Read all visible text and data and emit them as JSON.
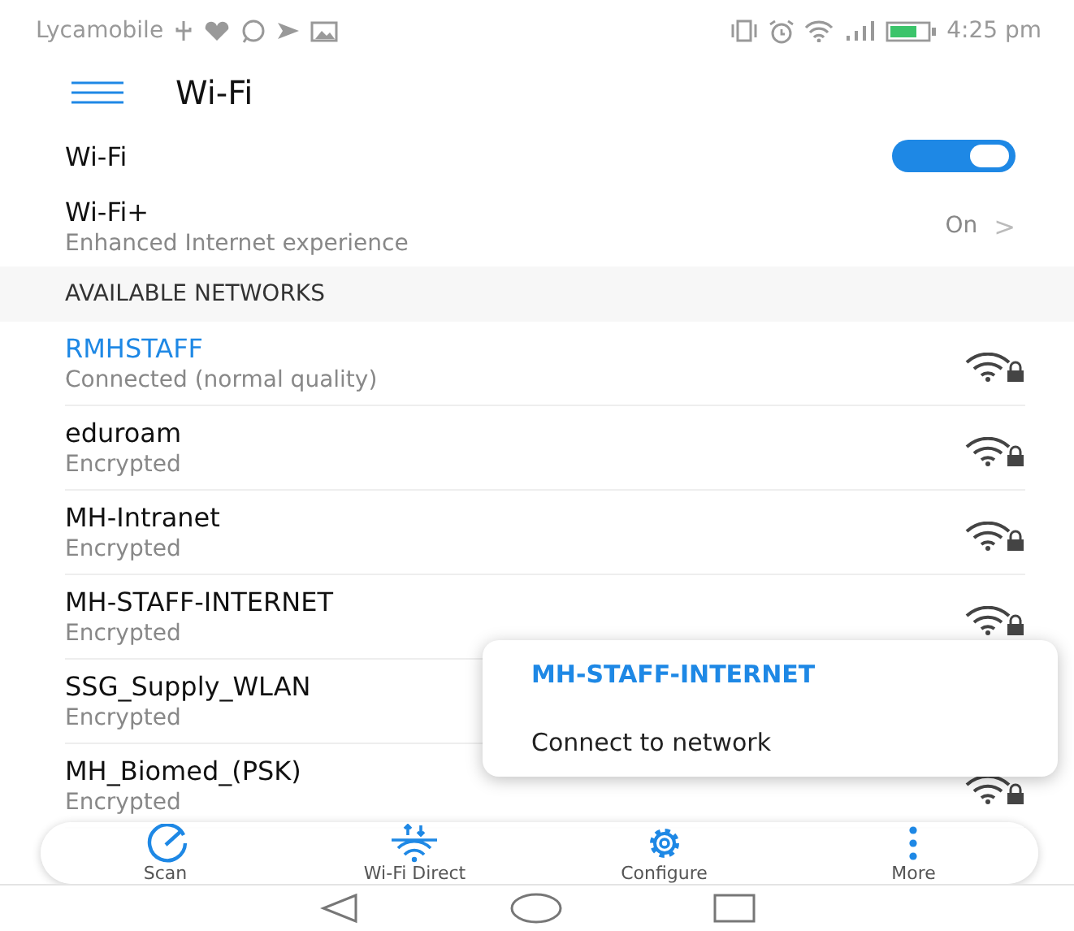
{
  "status_bar": {
    "carrier": "Lycamobile",
    "time": "4:25 pm"
  },
  "header": {
    "title": "Wi-Fi"
  },
  "settings": [
    {
      "kind": "toggle",
      "label": "Wi-Fi",
      "on": true
    },
    {
      "kind": "link",
      "label": "Wi-Fi+",
      "subtitle": "Enhanced Internet experience",
      "value": "On",
      "chevron": ">"
    }
  ],
  "section_title": "AVAILABLE NETWORKS",
  "networks": [
    {
      "name": "RMHSTAFF",
      "status": "Connected (normal quality)",
      "connected": true
    },
    {
      "name": "eduroam",
      "status": "Encrypted",
      "connected": false
    },
    {
      "name": "MH-Intranet",
      "status": "Encrypted",
      "connected": false
    },
    {
      "name": "MH-STAFF-INTERNET",
      "status": "Encrypted",
      "connected": false
    },
    {
      "name": "SSG_Supply_WLAN",
      "status": "Encrypted",
      "connected": false
    },
    {
      "name": "MH_Biomed_(PSK)",
      "status": "Encrypted",
      "connected": false
    }
  ],
  "popup": {
    "title": "MH-STAFF-INTERNET",
    "items": [
      "Connect to network"
    ]
  },
  "action_bar": [
    {
      "kind": "scan",
      "label": "Scan"
    },
    {
      "kind": "direct",
      "label": "Wi-Fi Direct"
    },
    {
      "kind": "configure",
      "label": "Configure"
    },
    {
      "kind": "more",
      "label": "More"
    }
  ]
}
